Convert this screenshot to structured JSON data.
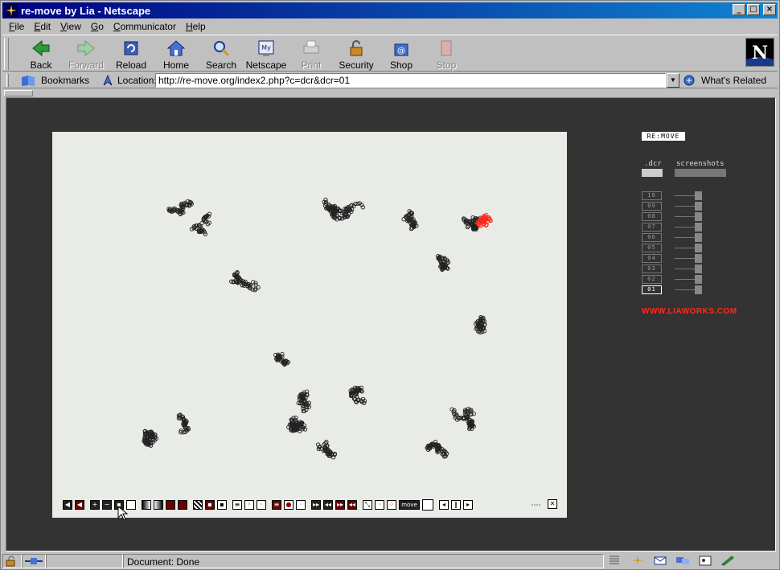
{
  "window": {
    "title": "re-move by Lia - Netscape"
  },
  "menu": [
    "File",
    "Edit",
    "View",
    "Go",
    "Communicator",
    "Help"
  ],
  "toolbar": {
    "buttons": [
      {
        "label": "Back",
        "enabled": true
      },
      {
        "label": "Forward",
        "enabled": false
      },
      {
        "label": "Reload",
        "enabled": true
      },
      {
        "label": "Home",
        "enabled": true
      },
      {
        "label": "Search",
        "enabled": true
      },
      {
        "label": "Netscape",
        "enabled": true
      },
      {
        "label": "Print",
        "enabled": false
      },
      {
        "label": "Security",
        "enabled": true
      },
      {
        "label": "Shop",
        "enabled": true
      },
      {
        "label": "Stop",
        "enabled": false
      }
    ]
  },
  "location": {
    "bookmarks_label": "Bookmarks",
    "location_label": "Location:",
    "url": "http://re-move.org/index2.php?c=dcr&dcr=01",
    "related_label": "What's Related"
  },
  "page": {
    "logo_text": "RE:MOVE",
    "tab_dcr": ".dcr",
    "tab_screenshots": "screenshots",
    "list_items": [
      "10",
      "09",
      "08",
      "07",
      "06",
      "05",
      "04",
      "03",
      "02",
      "01"
    ],
    "active_item": "01",
    "site_link": "WWW.LIAWORKS.COM",
    "accent_color": "#ff2a1a",
    "controls_move_label": "move"
  },
  "status": {
    "text": "Document: Done"
  }
}
